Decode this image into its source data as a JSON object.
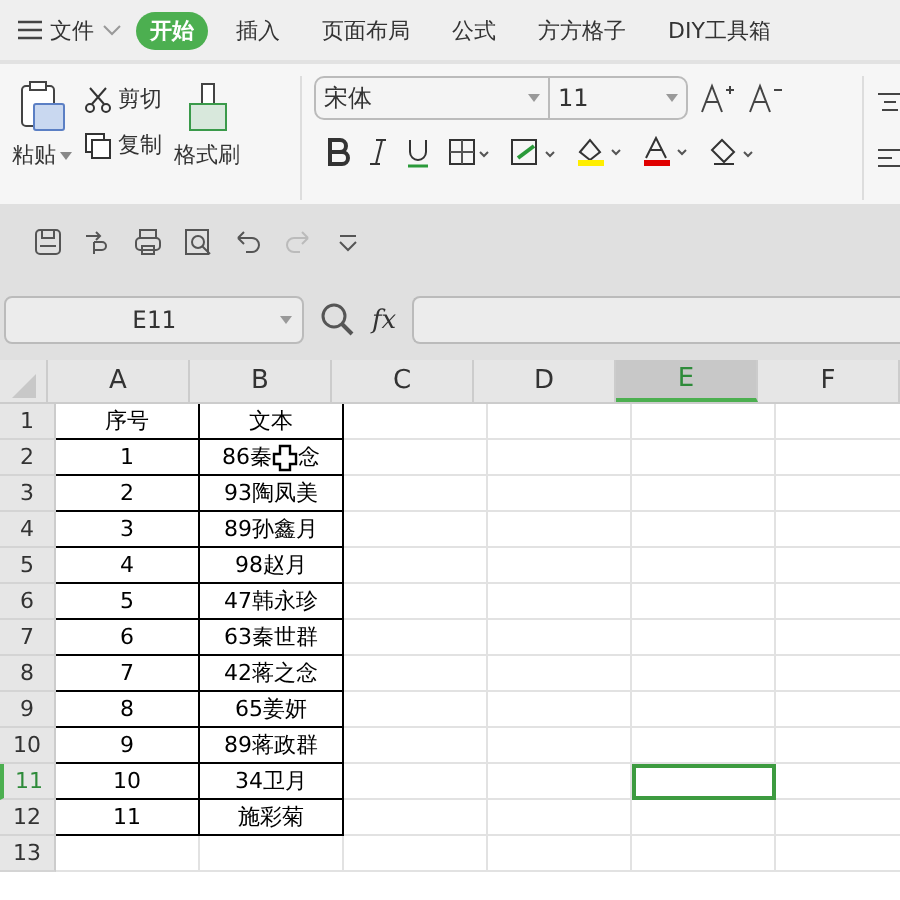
{
  "menu": {
    "file_label": "文件",
    "tabs": [
      {
        "label": "开始",
        "selected": true
      },
      {
        "label": "插入",
        "selected": false
      },
      {
        "label": "页面布局",
        "selected": false
      },
      {
        "label": "公式",
        "selected": false
      },
      {
        "label": "方方格子",
        "selected": false
      },
      {
        "label": "DIY工具箱",
        "selected": false
      }
    ]
  },
  "ribbon": {
    "paste": "粘贴",
    "cut": "剪切",
    "copy": "复制",
    "format_painter": "格式刷",
    "font_name": "宋体",
    "font_size": "11"
  },
  "name_box": "E11",
  "fx": "fx",
  "columns": [
    {
      "label": "A",
      "selected": false
    },
    {
      "label": "B",
      "selected": false
    },
    {
      "label": "C",
      "selected": false
    },
    {
      "label": "D",
      "selected": false
    },
    {
      "label": "E",
      "selected": true
    },
    {
      "label": "F",
      "selected": false
    }
  ],
  "rows": [
    {
      "number": "1",
      "selected": false,
      "a": "序号",
      "b": "文本"
    },
    {
      "number": "2",
      "selected": false,
      "a": "1",
      "b": "86秦",
      "b_rest": "念",
      "cursor": true
    },
    {
      "number": "3",
      "selected": false,
      "a": "2",
      "b": "93陶凤美"
    },
    {
      "number": "4",
      "selected": false,
      "a": "3",
      "b": "89孙鑫月"
    },
    {
      "number": "5",
      "selected": false,
      "a": "4",
      "b": "98赵月"
    },
    {
      "number": "6",
      "selected": false,
      "a": "5",
      "b": "47韩永珍"
    },
    {
      "number": "7",
      "selected": false,
      "a": "6",
      "b": "63秦世群"
    },
    {
      "number": "8",
      "selected": false,
      "a": "7",
      "b": "42蒋之念"
    },
    {
      "number": "9",
      "selected": false,
      "a": "8",
      "b": "65姜妍"
    },
    {
      "number": "10",
      "selected": false,
      "a": "9",
      "b": "89蒋政群"
    },
    {
      "number": "11",
      "selected": true,
      "a": "10",
      "b": "34卫月"
    },
    {
      "number": "12",
      "selected": false,
      "a": "11",
      "b": "施彩菊"
    },
    {
      "number": "13",
      "selected": false
    }
  ]
}
